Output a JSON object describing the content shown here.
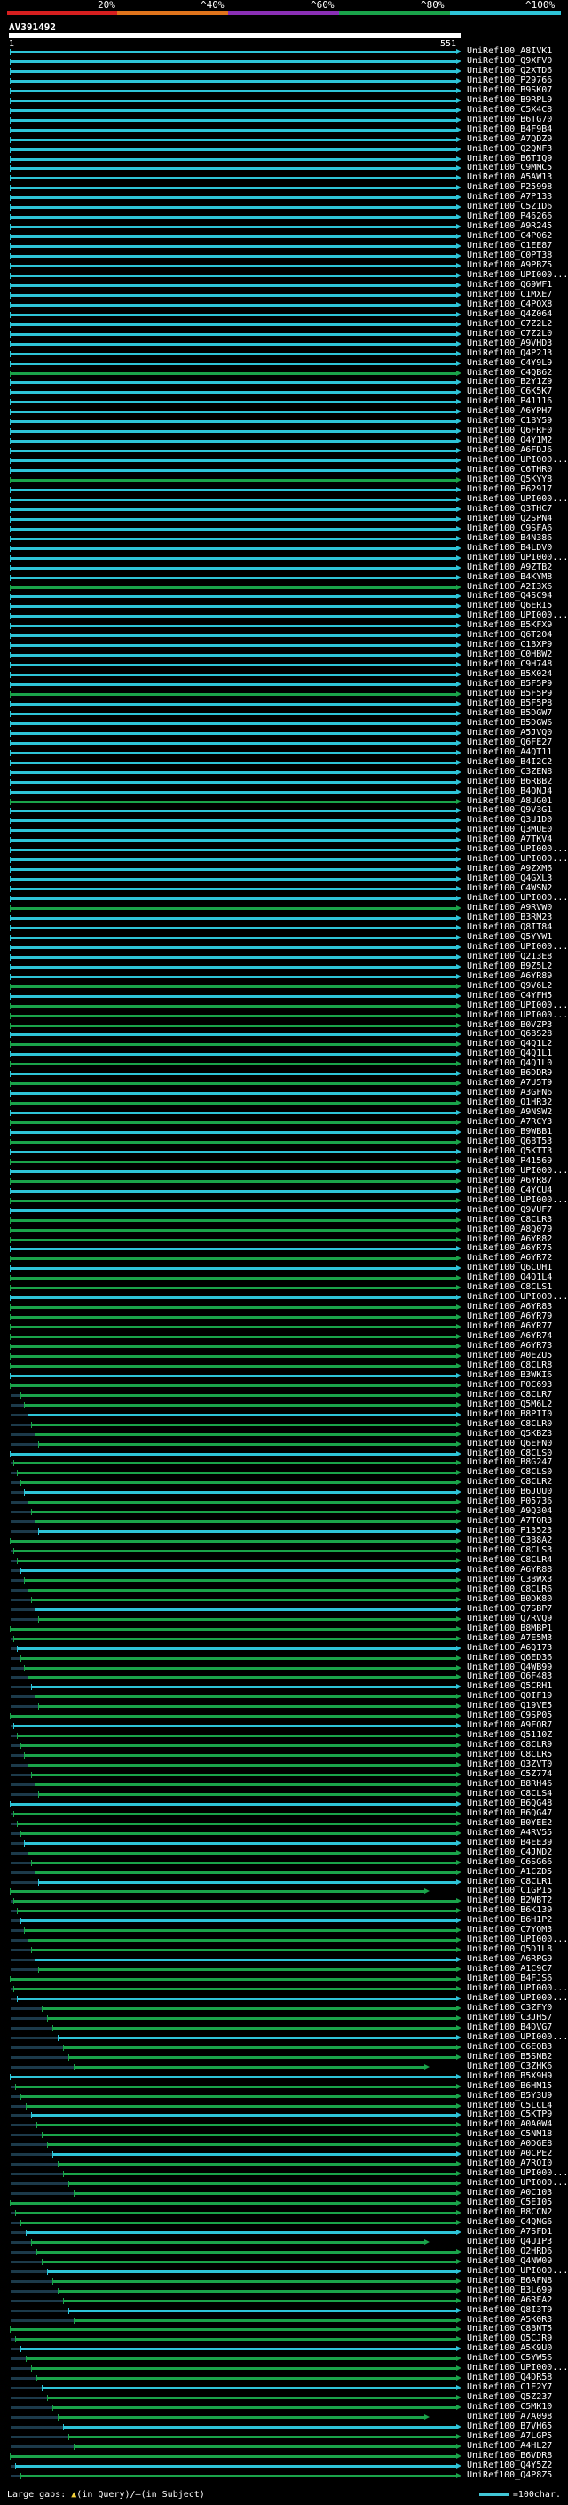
{
  "legend": {
    "colors": [
      "#d61f1f",
      "#e0741c",
      "#8a2fb5",
      "#1aa34a",
      "#2ec4d8"
    ],
    "labels": [
      "20%",
      "^40%",
      "^60%",
      "^80%",
      "^100%"
    ]
  },
  "query": {
    "name": "AV391492",
    "start": "1",
    "end": "551"
  },
  "hits": [
    "UniRef100_A8IVK1",
    "UniRef100_Q9XFV0",
    "UniRef100_Q2XTD6",
    "UniRef100_P29766",
    "UniRef100_B9SK07",
    "UniRef100_B9RPL9",
    "UniRef100_C5X4C8",
    "UniRef100_B6TG70",
    "UniRef100_B4F9B4",
    "UniRef100_A7QDZ9",
    "UniRef100_Q2QNF3",
    "UniRef100_B6TIQ9",
    "UniRef100_C9MMC5",
    "UniRef100_A5AW13",
    "UniRef100_P25998",
    "UniRef100_A7P133",
    "UniRef100_C5Z1D6",
    "UniRef100_P46266",
    "UniRef100_A9R245",
    "UniRef100_C4PQ62",
    "UniRef100_C1EE87",
    "UniRef100_C0PT38",
    "UniRef100_A9PBZ5",
    "UniRef100_UPI000...",
    "UniRef100_Q69WF1",
    "UniRef100_C1MXE7",
    "UniRef100_C4PQX8",
    "UniRef100_Q4Z064",
    "UniRef100_C7Z2L2",
    "UniRef100_C7Z2L0",
    "UniRef100_A9VHD3",
    "UniRef100_Q4P2J3",
    "UniRef100_C4Y9L9",
    "UniRef100_C4QB62",
    "UniRef100_B2Y1Z9",
    "UniRef100_C6K5K7",
    "UniRef100_P41116",
    "UniRef100_A6YPH7",
    "UniRef100_C1BY59",
    "UniRef100_Q6FRF0",
    "UniRef100_Q4Y1M2",
    "UniRef100_A6FDJ6",
    "UniRef100_UPI000...",
    "UniRef100_C6THR0",
    "UniRef100_Q5KYY8",
    "UniRef100_P62917",
    "UniRef100_UPI000...",
    "UniRef100_Q3THC7",
    "UniRef100_Q2SPN4",
    "UniRef100_C9SFA6",
    "UniRef100_B4N386",
    "UniRef100_B4LDV0",
    "UniRef100_UPI000...",
    "UniRef100_A9ZTB2",
    "UniRef100_B4KYM8",
    "UniRef100_A2I3X6",
    "UniRef100_Q4SC94",
    "UniRef100_Q6ERI5",
    "UniRef100_UPI000...",
    "UniRef100_B5KFX9",
    "UniRef100_Q6T204",
    "UniRef100_C1BXP9",
    "UniRef100_C0HBW2",
    "UniRef100_C9H748",
    "UniRef100_B5X024",
    "UniRef100_B5F5P9",
    "UniRef100_B5F5P9",
    "UniRef100_B5F5P8",
    "UniRef100_B5DGW7",
    "UniRef100_B5DGW6",
    "UniRef100_A5JVQ0",
    "UniRef100_Q6FE27",
    "UniRef100_A4QT11",
    "UniRef100_B4I2C2",
    "UniRef100_C3ZEN8",
    "UniRef100_B6RBB2",
    "UniRef100_B4QNJ4",
    "UniRef100_A8UG01",
    "UniRef100_Q9V3G1",
    "UniRef100_Q3U1D0",
    "UniRef100_Q3MUE0",
    "UniRef100_A7TKV4",
    "UniRef100_UPI000...",
    "UniRef100_UPI000...",
    "UniRef100_A9ZXM6",
    "UniRef100_Q4GXL3",
    "UniRef100_C4WSN2",
    "UniRef100_UPI000...",
    "UniRef100_A9RVW0",
    "UniRef100_B3RM23",
    "UniRef100_Q8IT84",
    "UniRef100_Q5YYW1",
    "UniRef100_UPI000...",
    "UniRef100_Q213E8",
    "UniRef100_B9Z5L2",
    "UniRef100_A6YR89",
    "UniRef100_Q9V6L2",
    "UniRef100_C4YFH5",
    "UniRef100_UPI000...",
    "UniRef100_UPI000...",
    "UniRef100_B0VZP3",
    "UniRef100_Q6BS28",
    "UniRef100_Q4Q1L2",
    "UniRef100_Q4Q1L1",
    "UniRef100_Q4Q1L0",
    "UniRef100_B6DDR9",
    "UniRef100_A7U5T9",
    "UniRef100_A3GFN6",
    "UniRef100_Q1HR32",
    "UniRef100_A9NSW2",
    "UniRef100_A7RCY3",
    "UniRef100_B9WBB1",
    "UniRef100_Q6BT53",
    "UniRef100_Q5KTT3",
    "UniRef100_P41569",
    "UniRef100_UPI000...",
    "UniRef100_A6YR87",
    "UniRef100_C4YCU4",
    "UniRef100_UPI000...",
    "UniRef100_Q9VUF7",
    "UniRef100_C8CLR3",
    "UniRef100_A8Q079",
    "UniRef100_A6YR82",
    "UniRef100_A6YR75",
    "UniRef100_A6YR72",
    "UniRef100_Q6CUH1",
    "UniRef100_Q4Q1L4",
    "UniRef100_C8CLS1",
    "UniRef100_UPI000...",
    "UniRef100_A6YR83",
    "UniRef100_A6YR79",
    "UniRef100_A6YR77",
    "UniRef100_A6YR74",
    "UniRef100_A6YR73",
    "UniRef100_A0EZU5",
    "UniRef100_C8CLR8",
    "UniRef100_B3WKI6",
    "UniRef100_P0C693",
    "UniRef100_C8CLR7",
    "UniRef100_Q5M6L2",
    "UniRef100_B8PII0",
    "UniRef100_C8CLR0",
    "UniRef100_Q5KBZ3",
    "UniRef100_Q6EFN0",
    "UniRef100_C8CLS0",
    "UniRef100_B8G247",
    "UniRef100_C8CLS0",
    "UniRef100_C8CLR2",
    "UniRef100_B6JUU0",
    "UniRef100_P05736",
    "UniRef100_A9Q304",
    "UniRef100_A7TQR3",
    "UniRef100_P13523",
    "UniRef100_C3B8A2",
    "UniRef100_C8CLS3",
    "UniRef100_C8CLR4",
    "UniRef100_A6YR88",
    "UniRef100_C3BWX3",
    "UniRef100_C8CLR6",
    "UniRef100_B0DK80",
    "UniRef100_Q7SBP7",
    "UniRef100_Q7RVQ9",
    "UniRef100_B8MBP1",
    "UniRef100_A7E5M3",
    "UniRef100_A6Q173",
    "UniRef100_Q6ED36",
    "UniRef100_Q4WB99",
    "UniRef100_Q6F483",
    "UniRef100_Q5CRH1",
    "UniRef100_Q0IF19",
    "UniRef100_Q19VE5",
    "UniRef100_C9SP05",
    "UniRef100_A9FQR7",
    "UniRef100_Q5110Z",
    "UniRef100_C8CLR9",
    "UniRef100_C8CLR5",
    "UniRef100_Q3ZVT0",
    "UniRef100_C5Z774",
    "UniRef100_B8RH46",
    "UniRef100_C8CLS4",
    "UniRef100_B6QG48",
    "UniRef100_B6QG47",
    "UniRef100_B0YEE2",
    "UniRef100_A4RV55",
    "UniRef100_B4EE39",
    "UniRef100_C4JND2",
    "UniRef100_C6SG66",
    "UniRef100_A1CZD5",
    "UniRef100_C8CLR1",
    "UniRef100_C1GPI5",
    "UniRef100_B2WBT2",
    "UniRef100_B6K139",
    "UniRef100_B6H1P2",
    "UniRef100_C7YQM3",
    "UniRef100_UPI000...",
    "UniRef100_Q5D1L8",
    "UniRef100_A6RPG9",
    "UniRef100_A1C9C7",
    "UniRef100_B4FJS6",
    "UniRef100_UPI000...",
    "UniRef100_UPI000...",
    "UniRef100_C3ZFY0",
    "UniRef100_C3JH57",
    "UniRef100_B4DVG7",
    "UniRef100_UPI000...",
    "UniRef100_C6EQB3",
    "UniRef100_B5SNB2",
    "UniRef100_C3ZHK6",
    "UniRef100_B5X9H9",
    "UniRef100_B6HM15",
    "UniRef100_B5Y3U9",
    "UniRef100_C5LCL4",
    "UniRef100_C5KTP9",
    "UniRef100_A0A0W4",
    "UniRef100_C5NM18",
    "UniRef100_A0DGE8",
    "UniRef100_A0CPE2",
    "UniRef100_A7RQI0",
    "UniRef100_UPI000...",
    "UniRef100_UPI000...",
    "UniRef100_A0C103",
    "UniRef100_C5EI05",
    "UniRef100_B8CCN2",
    "UniRef100_C4QNG6",
    "UniRef100_A7SFD1",
    "UniRef100_Q4UIP3",
    "UniRef100_Q2HRD6",
    "UniRef100_Q4NW09",
    "UniRef100_UPI000...",
    "UniRef100_B6AFN8",
    "UniRef100_B3L699",
    "UniRef100_A6RFA2",
    "UniRef100_Q8I3T9",
    "UniRef100_A5K0R3",
    "UniRef100_C8BNT5",
    "UniRef100_Q5CJR9",
    "UniRef100_A5K9U0",
    "UniRef100_C5YW56",
    "UniRef100_UPI000...",
    "UniRef100_Q4DR58",
    "UniRef100_C1E2Y7",
    "UniRef100_Q5Z237",
    "UniRef100_C5MK10",
    "UniRef100_A7A098",
    "UniRef100_B7VH65",
    "UniRef100_A7LGP5",
    "UniRef100_A4HL27",
    "UniRef100_B6VDR8",
    "UniRef100_Q4Y5Z2",
    "UniRef100_Q4P8Z5"
  ],
  "footer": {
    "large_gaps_label": "Large gaps:",
    "query_gap_label": "(in Query)",
    "subject_gap_label": "(in Subject)",
    "separator": "/",
    "scale_label": "=100char."
  }
}
